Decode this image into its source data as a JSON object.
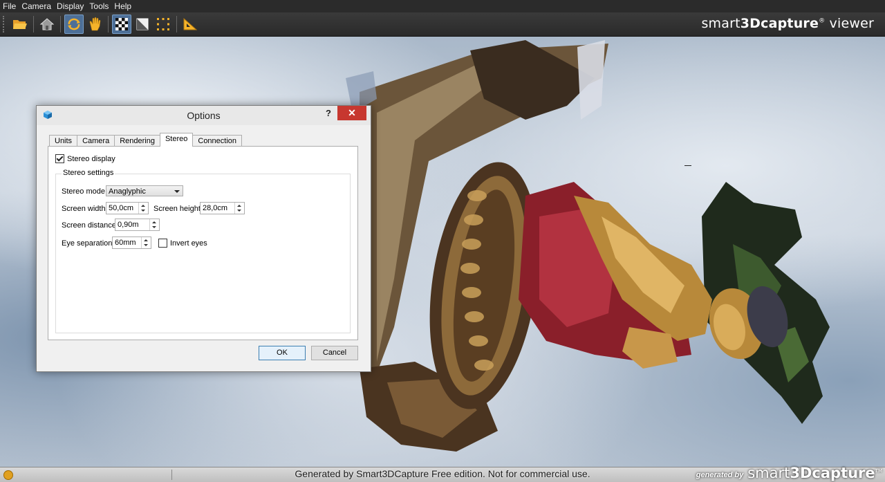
{
  "menu": [
    "File",
    "Camera",
    "Display",
    "Tools",
    "Help"
  ],
  "toolbar": {
    "buttons": [
      "open-folder-icon",
      "home-view-icon",
      "orbit-icon",
      "pan-hand-icon",
      "checkerboard-icon",
      "flat-shading-icon",
      "bounding-box-icon",
      "measure-icon"
    ],
    "brand_pre": "smart",
    "brand_bold": "3Dcapture",
    "brand_reg": "®",
    "brand_post": " viewer"
  },
  "dialog": {
    "title": "Options",
    "help": "?",
    "close": "✕",
    "tabs": [
      "Units",
      "Camera",
      "Rendering",
      "Stereo",
      "Connection"
    ],
    "active_tab": "Stereo",
    "stereo_display_label": "Stereo display",
    "stereo_display_checked": true,
    "group_title": "Stereo settings",
    "stereo_mode_label": "Stereo mode",
    "stereo_mode_value": "Anaglyphic",
    "screen_width_label": "Screen width",
    "screen_width_value": "50,0cm",
    "screen_height_label": "Screen height",
    "screen_height_value": "28,0cm",
    "screen_distance_label": "Screen distance",
    "screen_distance_value": "0,90m",
    "eye_separation_label": "Eye separation",
    "eye_separation_value": "60mm",
    "invert_eyes_label": "Invert eyes",
    "invert_eyes_checked": false,
    "ok_label": "OK",
    "cancel_label": "Cancel"
  },
  "status": {
    "watermark": "Generated by Smart3DCapture Free edition. Not for commercial use.",
    "generated_by": "generated by",
    "logo_pre": "smart",
    "logo_bold": "3Dcapture",
    "logo_tm": "TM"
  },
  "colors": {
    "menubar_bg": "#2b2b2b",
    "close_button": "#c7372f",
    "accent_icon": "#f5b32a",
    "active_tool": "#4d6f97"
  }
}
